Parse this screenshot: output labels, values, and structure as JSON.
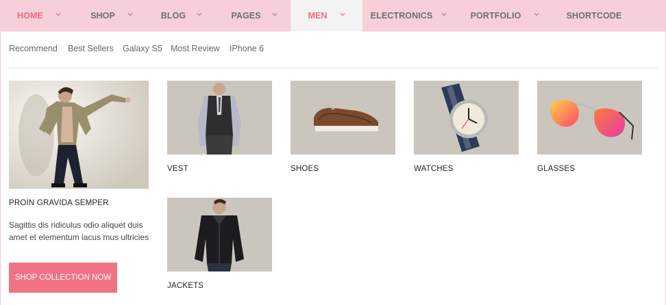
{
  "nav": {
    "items": [
      {
        "label": "HOME",
        "has_dropdown": true,
        "state": "current"
      },
      {
        "label": "SHOP",
        "has_dropdown": true
      },
      {
        "label": "BLOG",
        "has_dropdown": true
      },
      {
        "label": "PAGES",
        "has_dropdown": true
      },
      {
        "label": "MEN",
        "has_dropdown": true,
        "state": "open"
      },
      {
        "label": "ELECTRONICS",
        "has_dropdown": true
      },
      {
        "label": "PORTFOLIO",
        "has_dropdown": true
      },
      {
        "label": "SHORTCODE",
        "has_dropdown": false
      }
    ],
    "dropdown_icon": "chevron-down-icon"
  },
  "megamenu": {
    "subtabs": [
      "Recommend",
      "Best Sellers",
      "Galaxy S5",
      "Most Review",
      "IPhone 6"
    ],
    "featured": {
      "image": "model-in-jacket-photo",
      "title": "PROIN GRAVIDA SEMPER",
      "description": "Sagittis dis ridiculus odio aliquet duis amet et elementum lacus mus ultricies",
      "button": "SHOP COLLECTION NOW"
    },
    "products": [
      {
        "label": "VEST",
        "image": "vest-photo"
      },
      {
        "label": "SHOES",
        "image": "shoes-photo"
      },
      {
        "label": "WATCHES",
        "image": "watch-photo"
      },
      {
        "label": "GLASSES",
        "image": "sunglasses-photo"
      },
      {
        "label": "JACKETS",
        "image": "jacket-photo"
      }
    ]
  },
  "colors": {
    "nav_bg": "#f7cfd8",
    "accent": "#ef6b7f",
    "button_bg": "#f07384",
    "active_tab_bg": "#f3f3f3",
    "product_bg": "#cbc6bd"
  }
}
